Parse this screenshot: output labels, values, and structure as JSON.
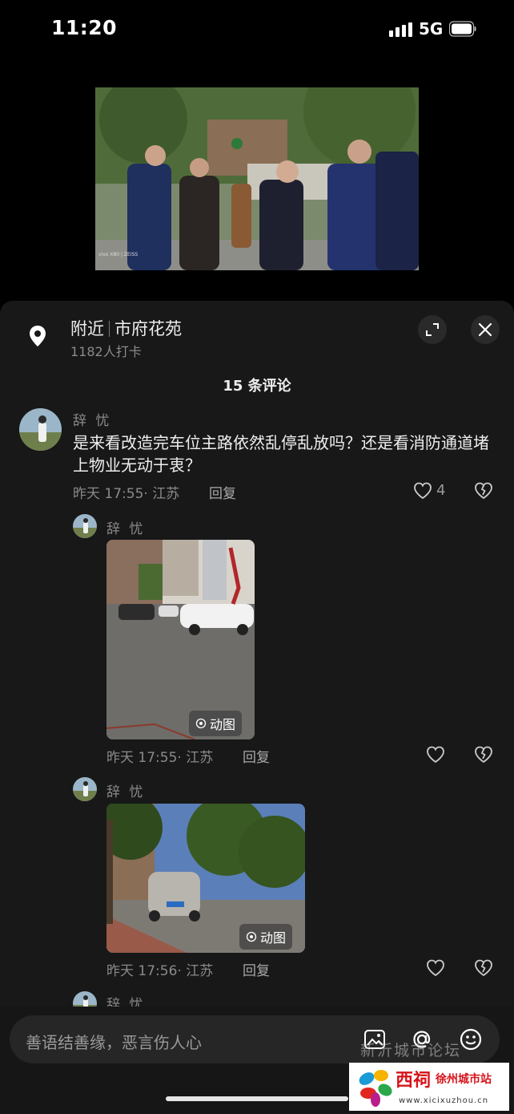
{
  "status_bar": {
    "time": "11:20",
    "network": "5G"
  },
  "video": {
    "watermark": "vivo X80 | ZEISS"
  },
  "location": {
    "prefix": "附近",
    "name": "市府花苑",
    "checkins": "1182人打卡"
  },
  "comments_header": "15 条评论",
  "comment": {
    "user": "辞 忧",
    "text": "是来看改造完车位主路依然乱停乱放吗？还是看消防通道堵上物业无动于衷？",
    "meta": "昨天 17:55· 江苏",
    "reply_label": "回复",
    "likes": "4"
  },
  "replies": [
    {
      "user": "辞 忧",
      "badge": "动图",
      "meta": "昨天 17:55· 江苏",
      "reply_label": "回复"
    },
    {
      "user": "辞 忧",
      "badge": "动图",
      "meta": "昨天 17:56· 江苏",
      "reply_label": "回复"
    },
    {
      "user": "辞 忧"
    }
  ],
  "input": {
    "placeholder": "善语结善缘，恶言伤人心"
  },
  "watermark": {
    "text": "新沂城市论坛",
    "logo_text": "西祠",
    "logo_sub": "徐州城市站",
    "logo_url": "www.xicixuzhou.cn"
  },
  "icons": [
    "pin-icon",
    "expand-icon",
    "close-icon",
    "heart-icon",
    "broken-heart-icon",
    "image-icon",
    "at-icon",
    "emoji-icon",
    "gif-icon"
  ],
  "colors": {
    "background": "#000000",
    "sheet": "#181818",
    "text": "#eeeeee",
    "muted": "#8a8a8a"
  }
}
